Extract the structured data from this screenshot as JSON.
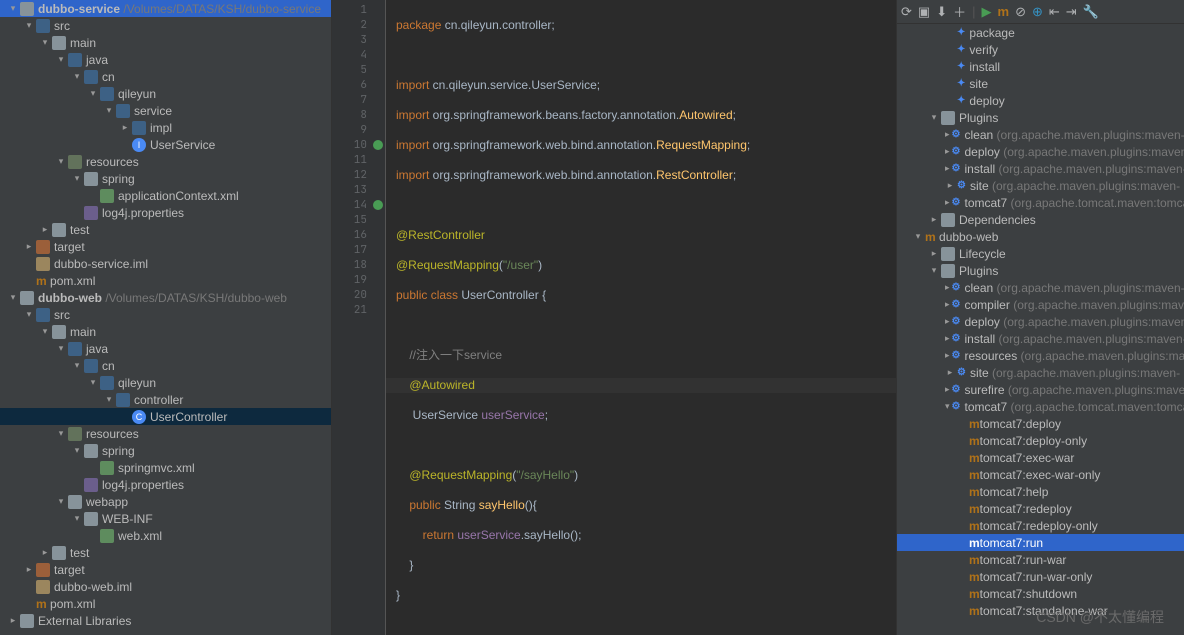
{
  "left": {
    "proj1": {
      "name": "dubbo-service",
      "path": "/Volumes/DATAS/KSH/dubbo-service"
    },
    "proj2": {
      "name": "dubbo-web",
      "path": "/Volumes/DATAS/KSH/dubbo-web"
    },
    "nodes": {
      "src": "src",
      "main": "main",
      "java": "java",
      "cn": "cn",
      "qileyun": "qileyun",
      "service": "service",
      "impl": "impl",
      "userservice": "UserService",
      "resources": "resources",
      "spring": "spring",
      "appctx": "applicationContext.xml",
      "log4j": "log4j.properties",
      "test": "test",
      "target": "target",
      "iml1": "dubbo-service.iml",
      "pom": "pom.xml",
      "controller": "controller",
      "usercontroller": "UserController",
      "springmvc": "springmvc.xml",
      "webapp": "webapp",
      "webinf": "WEB-INF",
      "webxml": "web.xml",
      "iml2": "dubbo-web.iml",
      "extlib": "External Libraries"
    }
  },
  "code": {
    "l1a": "package",
    "l1b": " cn.qileyun.controller;",
    "l3a": "import",
    "l3b": " cn.qileyun.service.UserService;",
    "l4a": "import",
    "l4b": " org.springframework.beans.factory.annotation.",
    "l4c": "Autowired",
    "l4d": ";",
    "l5a": "import",
    "l5b": " org.springframework.web.bind.annotation.",
    "l5c": "RequestMapping",
    "l5d": ";",
    "l6a": "import",
    "l6b": " org.springframework.web.bind.annotation.",
    "l6c": "RestController",
    "l6d": ";",
    "l8": "@RestController",
    "l9a": "@RequestMapping",
    "l9b": "(",
    "l9c": "\"/user\"",
    "l9d": ")",
    "l10a": "public class ",
    "l10b": "UserController {",
    "l12": "    //注入一下service",
    "l13": "    @Autowired",
    "l14a": "     UserService ",
    "l14b": "userService",
    "l14c": ";",
    "l16a": "    @RequestMapping",
    "l16b": "(",
    "l16c": "\"/sayHello\"",
    "l16d": ")",
    "l17a": "    public ",
    "l17b": "String ",
    "l17c": "sayHello",
    "l17d": "(){",
    "l18a": "        return ",
    "l18b": "userService",
    "l18c": ".sayHello();",
    "l19": "    }",
    "l20": "}"
  },
  "chart_data": null,
  "right": {
    "top": {
      "verify": "verify",
      "install": "install",
      "site": "site",
      "deploy": "deploy",
      "package": "package"
    },
    "plugins": "Plugins",
    "hint": "(org.apache.maven.plugins:maven-",
    "hintTomcat": "(org.apache.tomcat.maven:tomcat",
    "pluginList1": {
      "clean": "clean",
      "deploy": "deploy",
      "install": "install",
      "site": "site",
      "tomcat7": "tomcat7"
    },
    "deps": "Dependencies",
    "dubboweb": "dubbo-web",
    "lifecycle": "Lifecycle",
    "pluginList2": {
      "clean": "clean",
      "compiler": "compiler",
      "deploy": "deploy",
      "install": "install",
      "resources": "resources",
      "site": "site",
      "surefire": "surefire",
      "tomcat7": "tomcat7"
    },
    "goals": {
      "deploy": "tomcat7:deploy",
      "deployonly": "tomcat7:deploy-only",
      "execwar": "tomcat7:exec-war",
      "execwaronly": "tomcat7:exec-war-only",
      "help": "tomcat7:help",
      "redeploy": "tomcat7:redeploy",
      "redeployonly": "tomcat7:redeploy-only",
      "run": "tomcat7:run",
      "runwar": "tomcat7:run-war",
      "runwaronly": "tomcat7:run-war-only",
      "shutdown": "tomcat7:shutdown",
      "standalonewar": "tomcat7:standalone-war"
    }
  },
  "watermark": "CSDN @不太懂编程"
}
